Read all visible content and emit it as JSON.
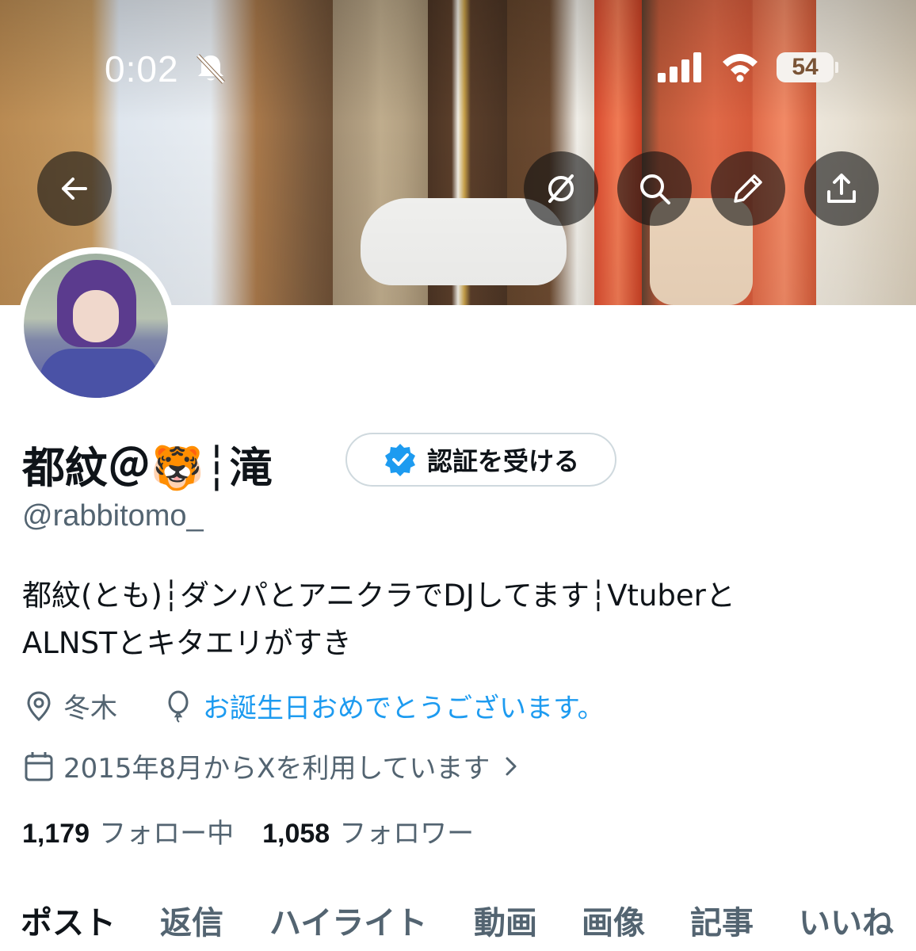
{
  "status_bar": {
    "time": "0:02",
    "battery": "54"
  },
  "nav": {
    "back_icon": "arrow-left-icon",
    "grok_icon": "grok-icon",
    "search_icon": "search-icon",
    "edit_icon": "pencil-icon",
    "share_icon": "share-icon"
  },
  "profile": {
    "display_name": "都紋＠🐯┆滝",
    "verify_label": "認証を受ける",
    "handle": "@rabbitomo_",
    "bio_line1": "都紋(とも)┆ダンパとアニクラでDJしてます┆Vtuberと",
    "bio_line2": "ALNSTとキタエリがすき",
    "location": "冬木",
    "birthday": "お誕生日おめでとうございます。",
    "joined": "2015年8月からXを利用しています"
  },
  "stats": {
    "following_count": "1,179",
    "following_label": "フォロー中",
    "followers_count": "1,058",
    "followers_label": "フォロワー"
  },
  "tabs": [
    {
      "label": "ポスト",
      "active": true
    },
    {
      "label": "返信",
      "active": false
    },
    {
      "label": "ハイライト",
      "active": false
    },
    {
      "label": "動画",
      "active": false
    },
    {
      "label": "画像",
      "active": false
    },
    {
      "label": "記事",
      "active": false
    },
    {
      "label": "いいね",
      "active": false
    }
  ],
  "colors": {
    "accent": "#1d9bf0",
    "text": "#0f1419",
    "secondary": "#536471",
    "border": "#cfd9de"
  }
}
